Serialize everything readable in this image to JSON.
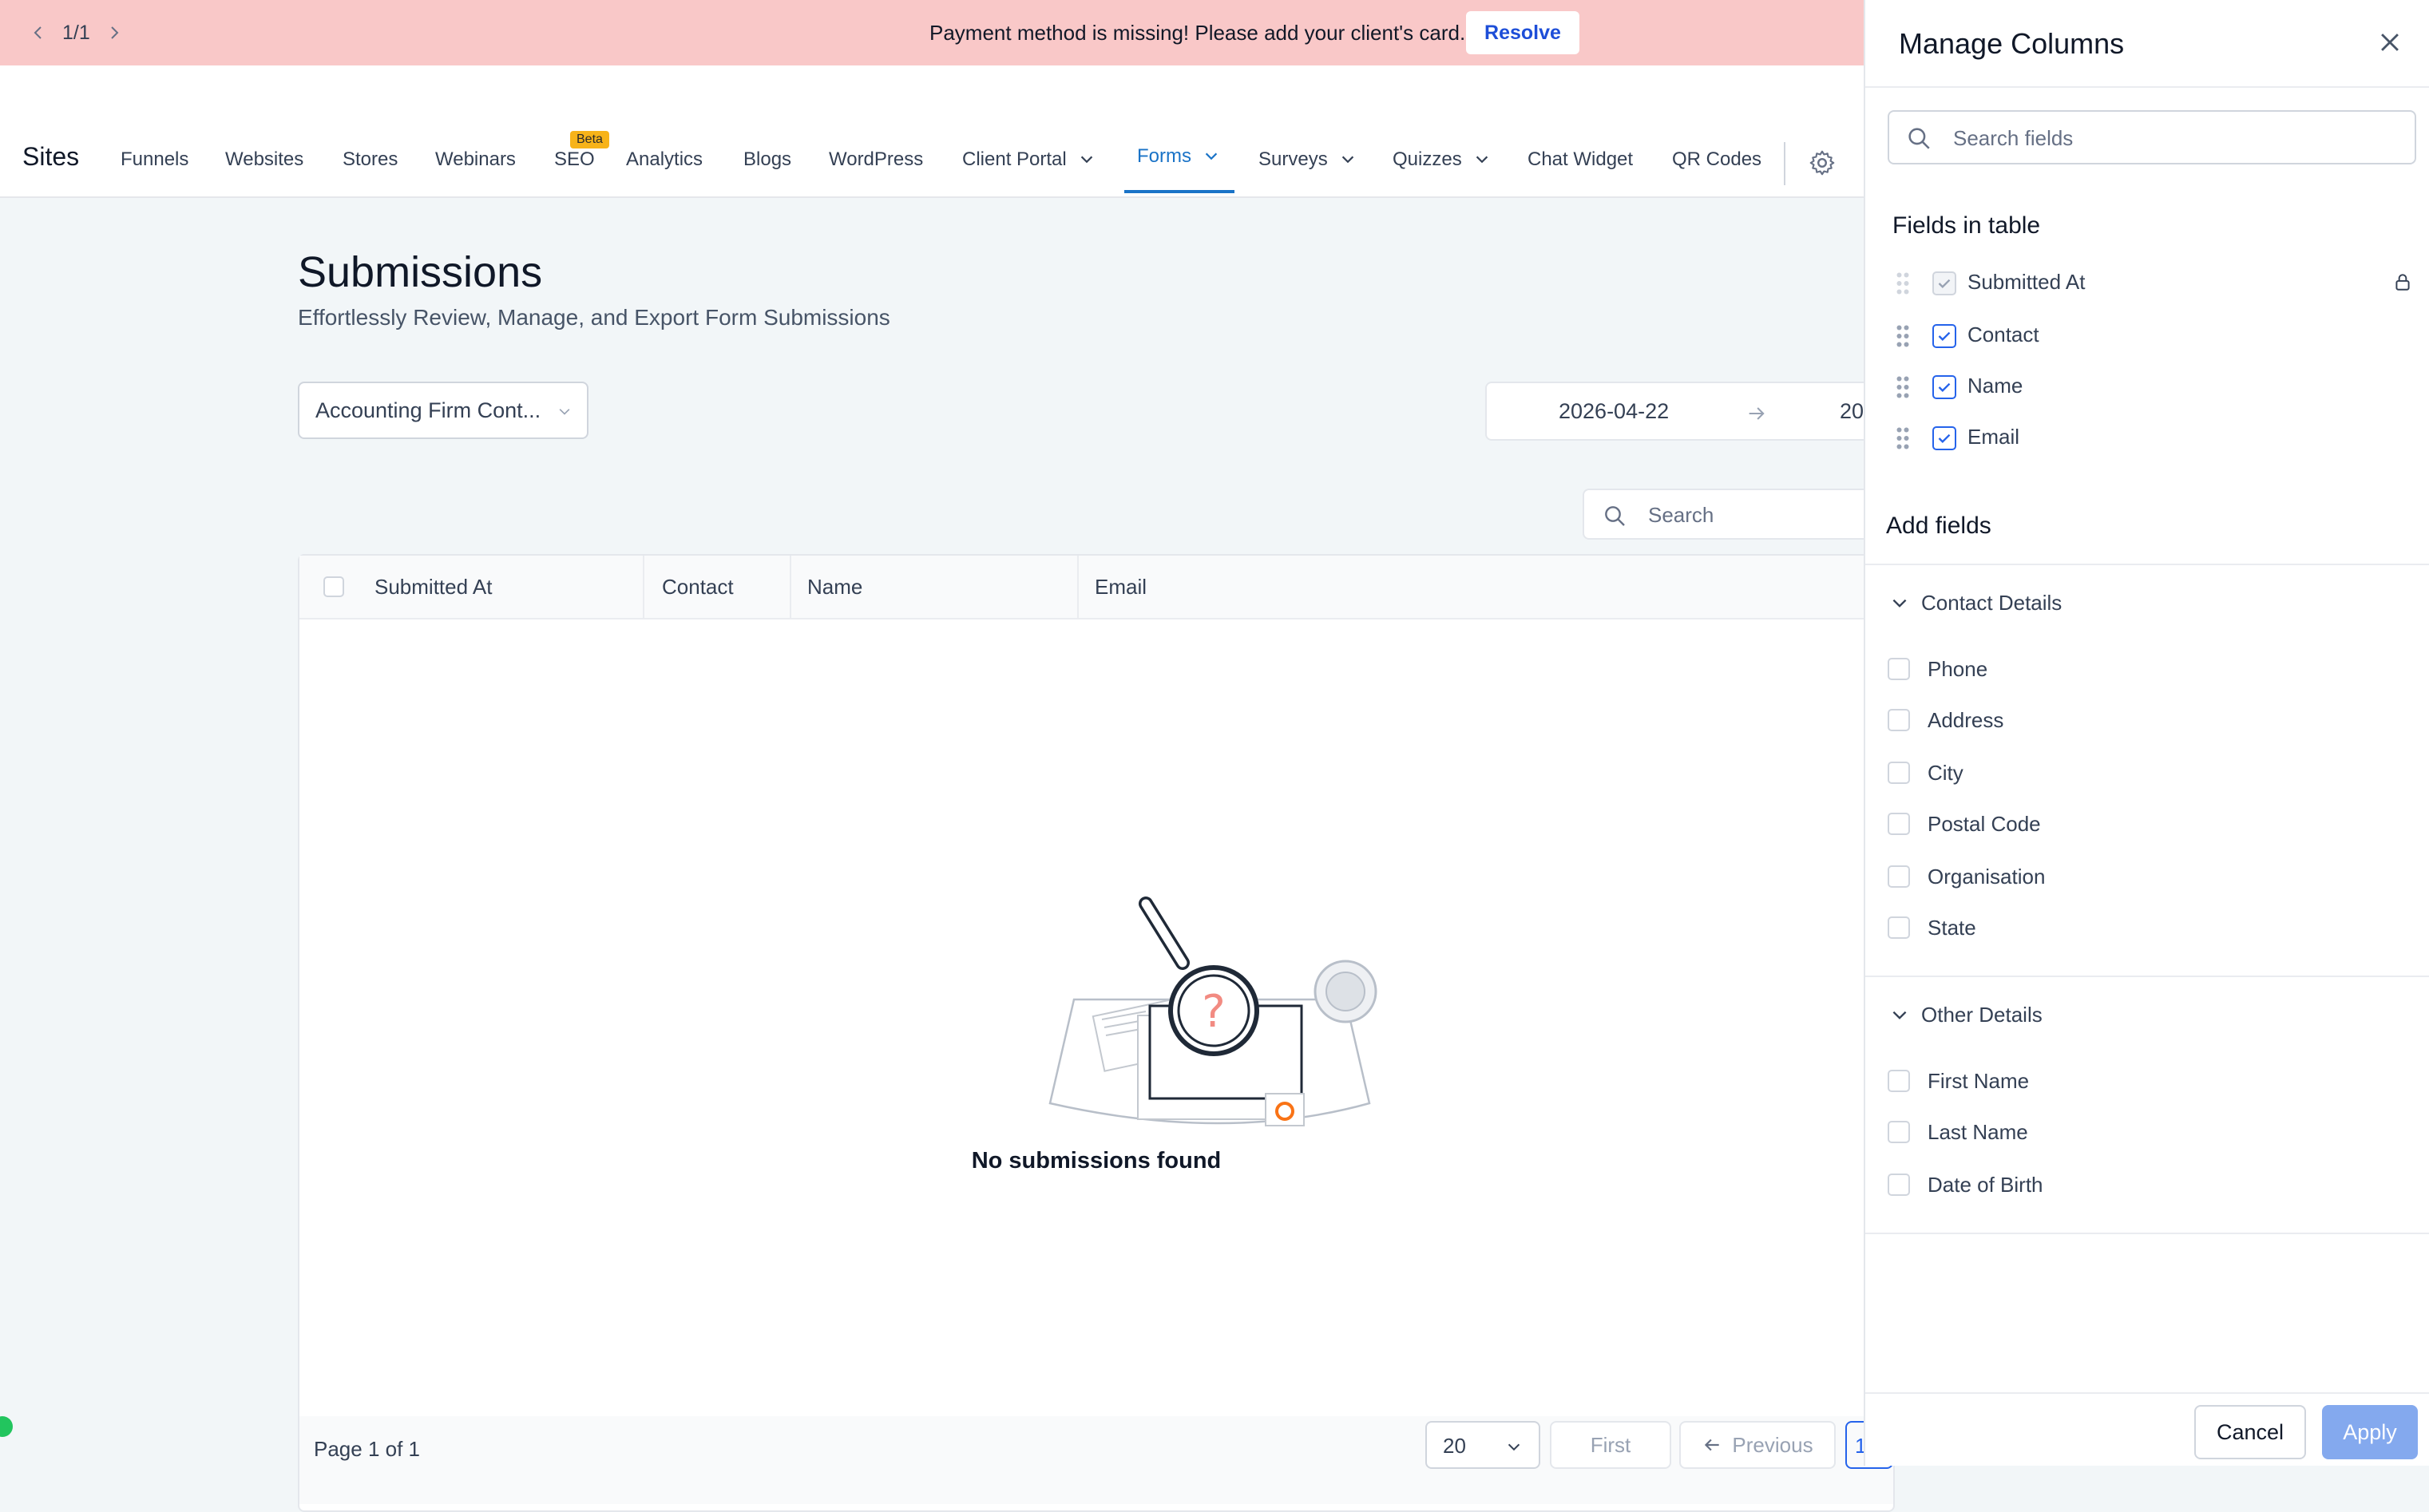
{
  "banner": {
    "pager": "1/1",
    "message": "Payment method is missing! Please add your client's card.",
    "resolve_label": "Resolve",
    "bg_color": "#f9c8c8"
  },
  "nav": {
    "brand": "Sites",
    "items": [
      {
        "label": "Funnels"
      },
      {
        "label": "Websites"
      },
      {
        "label": "Stores"
      },
      {
        "label": "Webinars"
      },
      {
        "label": "SEO",
        "badge": "Beta"
      },
      {
        "label": "Analytics"
      },
      {
        "label": "Blogs"
      },
      {
        "label": "WordPress"
      },
      {
        "label": "Client Portal"
      },
      {
        "label": "Forms",
        "active": true
      },
      {
        "label": "Surveys"
      },
      {
        "label": "Quizzes"
      },
      {
        "label": "Chat Widget"
      },
      {
        "label": "QR Codes"
      }
    ],
    "active_color": "#1a73c7"
  },
  "page": {
    "title": "Submissions",
    "subtitle": "Effortlessly Review, Manage, and Export Form Submissions",
    "form_select": "Accounting Firm Cont...",
    "date_start": "2026-04-22",
    "date_end_visible": "20",
    "search_placeholder": "Search"
  },
  "table": {
    "headers": [
      "Submitted At",
      "Contact",
      "Name",
      "Email"
    ],
    "empty_text": "No submissions found"
  },
  "pagination": {
    "page_label": "Page 1 of 1",
    "per_page": "20",
    "first_label": "First",
    "previous_label": "Previous",
    "current_page_visible": "1"
  },
  "panel": {
    "title": "Manage Columns",
    "search_placeholder": "Search fields",
    "fields_in_table_heading": "Fields in table",
    "fields_in_table": [
      {
        "label": "Submitted At",
        "checked": true,
        "locked": true
      },
      {
        "label": "Contact",
        "checked": true
      },
      {
        "label": "Name",
        "checked": true
      },
      {
        "label": "Email",
        "checked": true
      }
    ],
    "add_fields_heading": "Add fields",
    "groups": [
      {
        "label": "Contact Details",
        "options": [
          "Phone",
          "Address",
          "City",
          "Postal Code",
          "Organisation",
          "State"
        ]
      },
      {
        "label": "Other Details",
        "options": [
          "First Name",
          "Last Name",
          "Date of Birth"
        ]
      }
    ],
    "cancel_label": "Cancel",
    "apply_label": "Apply",
    "apply_color": "#84a9ee"
  },
  "icons": {
    "pager_prev": "chevron-left-icon",
    "pager_next": "chevron-right-icon",
    "settings": "gear-icon",
    "search": "search-icon",
    "close": "close-icon",
    "lock": "lock-icon",
    "drag": "drag-handle-icon"
  }
}
